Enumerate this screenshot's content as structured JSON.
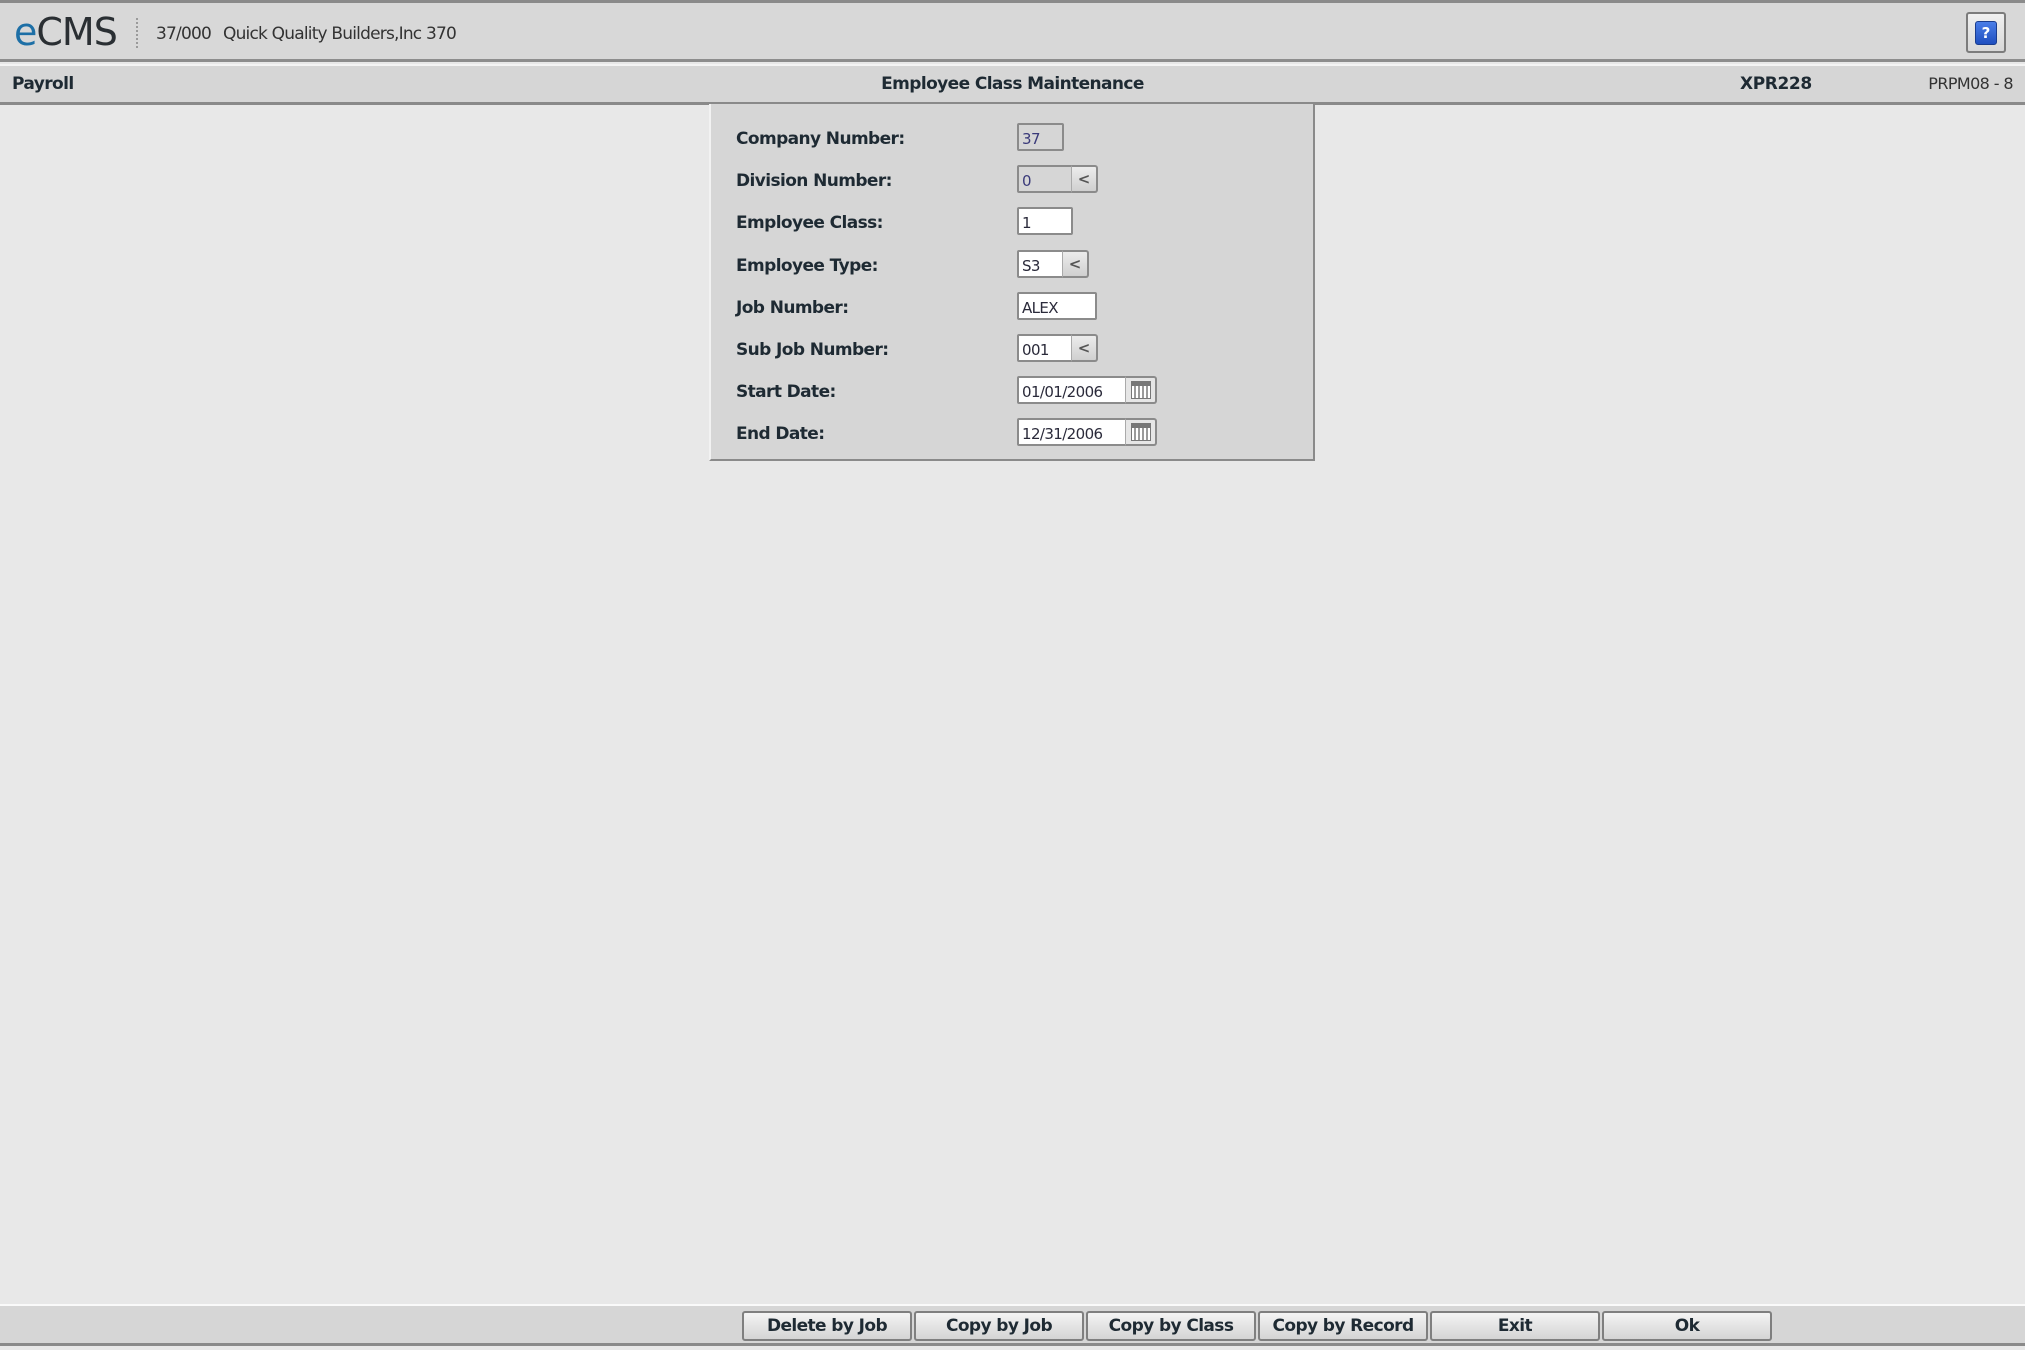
{
  "app": {
    "logo_prefix": "e",
    "logo_suffix": "CMS",
    "company_code": "37/000",
    "company_name": "Quick Quality Builders,Inc 370",
    "help_symbol": "?",
    "help_icon": "help-icon"
  },
  "subheader": {
    "module": "Payroll",
    "title": "Employee Class Maintenance",
    "program": "XPR228",
    "screen_id": "PRPM08 - 8"
  },
  "form": {
    "fields": [
      {
        "label": "Company Number:",
        "value": "37",
        "readonly": true
      },
      {
        "label": "Division Number:",
        "value": "0",
        "readonly": true,
        "lookup": "<"
      },
      {
        "label": "Employee Class:",
        "value": "1"
      },
      {
        "label": "Employee Type:",
        "value": "S3",
        "lookup": "<"
      },
      {
        "label": "Job Number:",
        "value": "ALEX"
      },
      {
        "label": "Sub Job Number:",
        "value": "001",
        "lookup": "<"
      },
      {
        "label": "Start Date:",
        "value": "01/01/2006",
        "calendar_icon": "calendar-icon"
      },
      {
        "label": "End Date:",
        "value": "12/31/2006",
        "calendar_icon": "calendar-icon"
      }
    ]
  },
  "footer": {
    "buttons": [
      {
        "label": "Delete by Job"
      },
      {
        "label": "Copy by Job"
      },
      {
        "label": "Copy by Class"
      },
      {
        "label": "Copy by Record"
      },
      {
        "label": "Exit"
      },
      {
        "label": "Ok"
      }
    ]
  },
  "colors": {
    "logo_accent": "#1d6fa6",
    "help_icon_blue": "#2f62d6",
    "background": "#e8e8e8",
    "panel": "#d6d6d6"
  }
}
